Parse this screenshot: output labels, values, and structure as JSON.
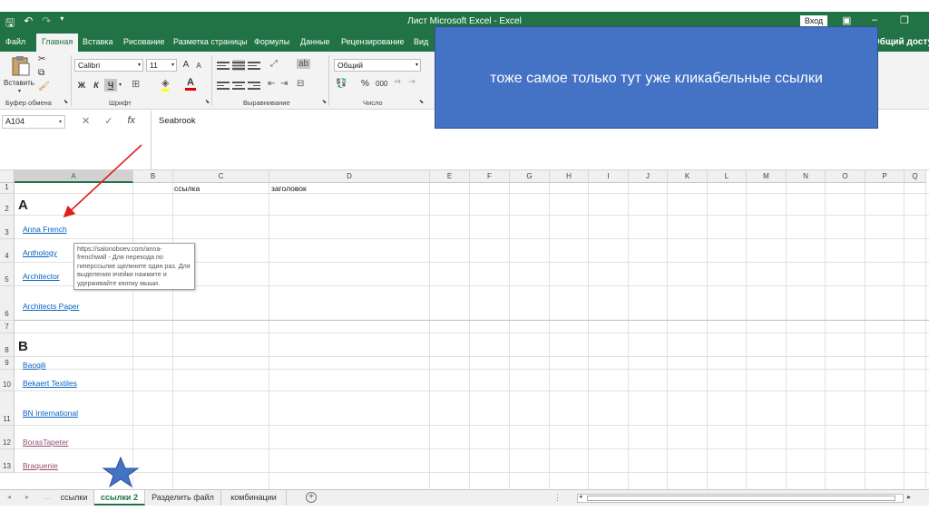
{
  "titlebar": {
    "title": "Лист Microsoft Excel  -  Excel",
    "signin": "Вход",
    "save_icon": "save-icon",
    "undo_icon": "undo-icon",
    "redo_icon": "redo-icon"
  },
  "tabs": [
    "Файл",
    "Главная",
    "Вставка",
    "Рисование",
    "Разметка страницы",
    "Формулы",
    "Данные",
    "Рецензирование",
    "Вид"
  ],
  "share_label": "Общий доступ",
  "ribbon": {
    "paste_label": "Вставить",
    "clipboard_group": "Буфер обмена",
    "font_name": "Calibri",
    "font_size": "11",
    "grow_font": "A",
    "shrink_font": "A",
    "bold": "Ж",
    "italic": "К",
    "underline": "Ч",
    "font_color_letter": "A",
    "font_group": "Шрифт",
    "align_group": "Выравнивание",
    "number_format": "Общий",
    "percent": "%",
    "thousands": "000",
    "number_group": "Число"
  },
  "formula_bar": {
    "cell_ref": "A104",
    "fx": "fx",
    "cancel": "✕",
    "enter": "✓",
    "content": "Seabrook"
  },
  "columns": [
    "A",
    "B",
    "C",
    "D",
    "E",
    "F",
    "G",
    "H",
    "I",
    "J",
    "K",
    "L",
    "M",
    "N",
    "O",
    "P",
    "Q"
  ],
  "rows": [
    "1",
    "2",
    "3",
    "4",
    "5",
    "6",
    "7",
    "8",
    "9",
    "10",
    "11",
    "12",
    "13"
  ],
  "cells": {
    "c1": "ссылка",
    "d1": "заголовок",
    "a2": "A",
    "a3": "Anna French",
    "a4": "Anthology",
    "a5": "Architector",
    "a6": "Architects Paper",
    "a8": "B",
    "a9": "Baoqili",
    "a10": "Bekaert Textiles",
    "a11": "BN International",
    "a12": "BorasTapeter",
    "a13": "Braquenie"
  },
  "tooltip": "https://salonoboev.com/anna-frenchwall - Для перехода по гиперссылке щелкните один раз. Для выделения ячейки нажмите и удерживайте кнопку мыши.",
  "sheets": [
    "ссылки",
    "ссылки 2",
    "Разделить файл",
    "комбинации"
  ],
  "active_sheet": "ссылки 2",
  "callout": "тоже самое только тут уже кликабельные ссылки",
  "colors": {
    "excel_green": "#217346",
    "callout_blue": "#4472c4",
    "link_blue": "#0563c1",
    "visited_purple": "#954f72",
    "arrow_red": "#e02020",
    "star_fill": "#4472c4"
  }
}
